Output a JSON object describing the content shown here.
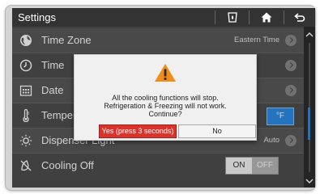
{
  "header": {
    "title": "Settings",
    "icons": [
      "filter-icon",
      "home-icon",
      "back-icon"
    ]
  },
  "rows": [
    {
      "label": "Time Zone",
      "value": "Eastern Time",
      "icon": "globe-icon"
    },
    {
      "label": "Time",
      "value": "",
      "icon": "clock-icon"
    },
    {
      "label": "Date",
      "value": "",
      "icon": "calendar-icon"
    },
    {
      "label": "Tempera",
      "value": "°F",
      "icon": "thermometer-icon"
    },
    {
      "label": "Dispenser Light",
      "value": "Auto",
      "icon": "light-icon"
    },
    {
      "label": "Cooling Off",
      "icon": "cooling-off-icon",
      "toggle": {
        "on": "ON",
        "off": "OFF"
      }
    }
  ],
  "dialog": {
    "icon": "warning-icon",
    "lines": [
      "All the cooling functions will stop.",
      "Refrigeration & Freezing will not work.",
      "Continue?"
    ],
    "confirm_label": "Yes (press 3 seconds)",
    "cancel_label": "No"
  },
  "colors": {
    "accent_blue": "#2b8de8",
    "confirm_red": "#d9342b",
    "warning_orange": "#f08c18"
  }
}
